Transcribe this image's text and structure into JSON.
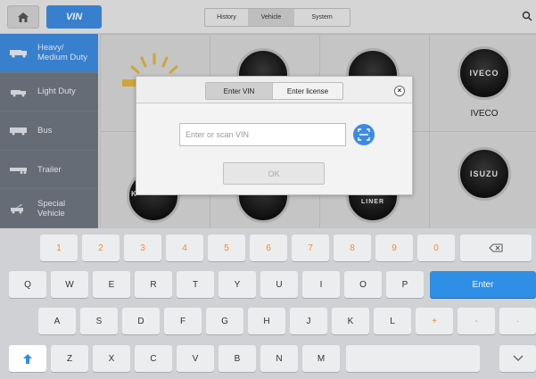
{
  "topbar": {
    "home_icon": "home-icon",
    "vin_button_label": "VIN",
    "tabs": [
      {
        "label": "History",
        "active": false
      },
      {
        "label": "Vehicle",
        "active": true
      },
      {
        "label": "System",
        "active": false
      }
    ],
    "search_icon": "search-icon"
  },
  "sidebar": {
    "items": [
      {
        "label": "Heavy/\nMedium Duty",
        "icon": "heavy-truck-icon",
        "active": true
      },
      {
        "label": "Light Duty",
        "icon": "light-truck-icon",
        "active": false
      },
      {
        "label": "Bus",
        "icon": "bus-icon",
        "active": false
      },
      {
        "label": "Trailer",
        "icon": "trailer-icon",
        "active": false
      },
      {
        "label": "Special\nVehicle",
        "icon": "special-vehicle-icon",
        "active": false
      }
    ]
  },
  "grid": {
    "brands": [
      {
        "badge_text": "",
        "label": ""
      },
      {
        "badge_text": "",
        "label": ""
      },
      {
        "badge_text": "",
        "label": ""
      },
      {
        "badge_text": "IVECO",
        "label": "IVECO"
      },
      {
        "badge_text": "K",
        "label": ""
      },
      {
        "badge_text": "",
        "label": ""
      },
      {
        "badge_text": "LINER",
        "label": ""
      },
      {
        "badge_text": "ISUZU",
        "label": ""
      }
    ]
  },
  "dialog": {
    "tabs": [
      {
        "label": "Enter VIN",
        "active": true
      },
      {
        "label": "Enter license",
        "active": false
      }
    ],
    "close_icon": "close-icon",
    "input": {
      "placeholder": "Enter or scan VIN",
      "value": ""
    },
    "scan_icon": "scan-icon",
    "ok_label": "OK"
  },
  "keyboard": {
    "row1": [
      "1",
      "2",
      "3",
      "4",
      "5",
      "6",
      "7",
      "8",
      "9",
      "0"
    ],
    "row2": [
      "Q",
      "W",
      "E",
      "R",
      "T",
      "Y",
      "U",
      "I",
      "O",
      "P"
    ],
    "row3": [
      "A",
      "S",
      "D",
      "F",
      "G",
      "H",
      "J",
      "K",
      "L",
      "+",
      "-",
      "·"
    ],
    "row4": [
      "Z",
      "X",
      "C",
      "V",
      "B",
      "N",
      "M"
    ],
    "enter_label": "Enter",
    "backspace_icon": "backspace-icon",
    "shift_icon": "shift-icon",
    "hide_keyboard_icon": "hide-keyboard-icon"
  },
  "colors": {
    "accent": "#3d8be0",
    "key_orange": "#f28a2e",
    "sidebar_bg": "#6f7680"
  }
}
